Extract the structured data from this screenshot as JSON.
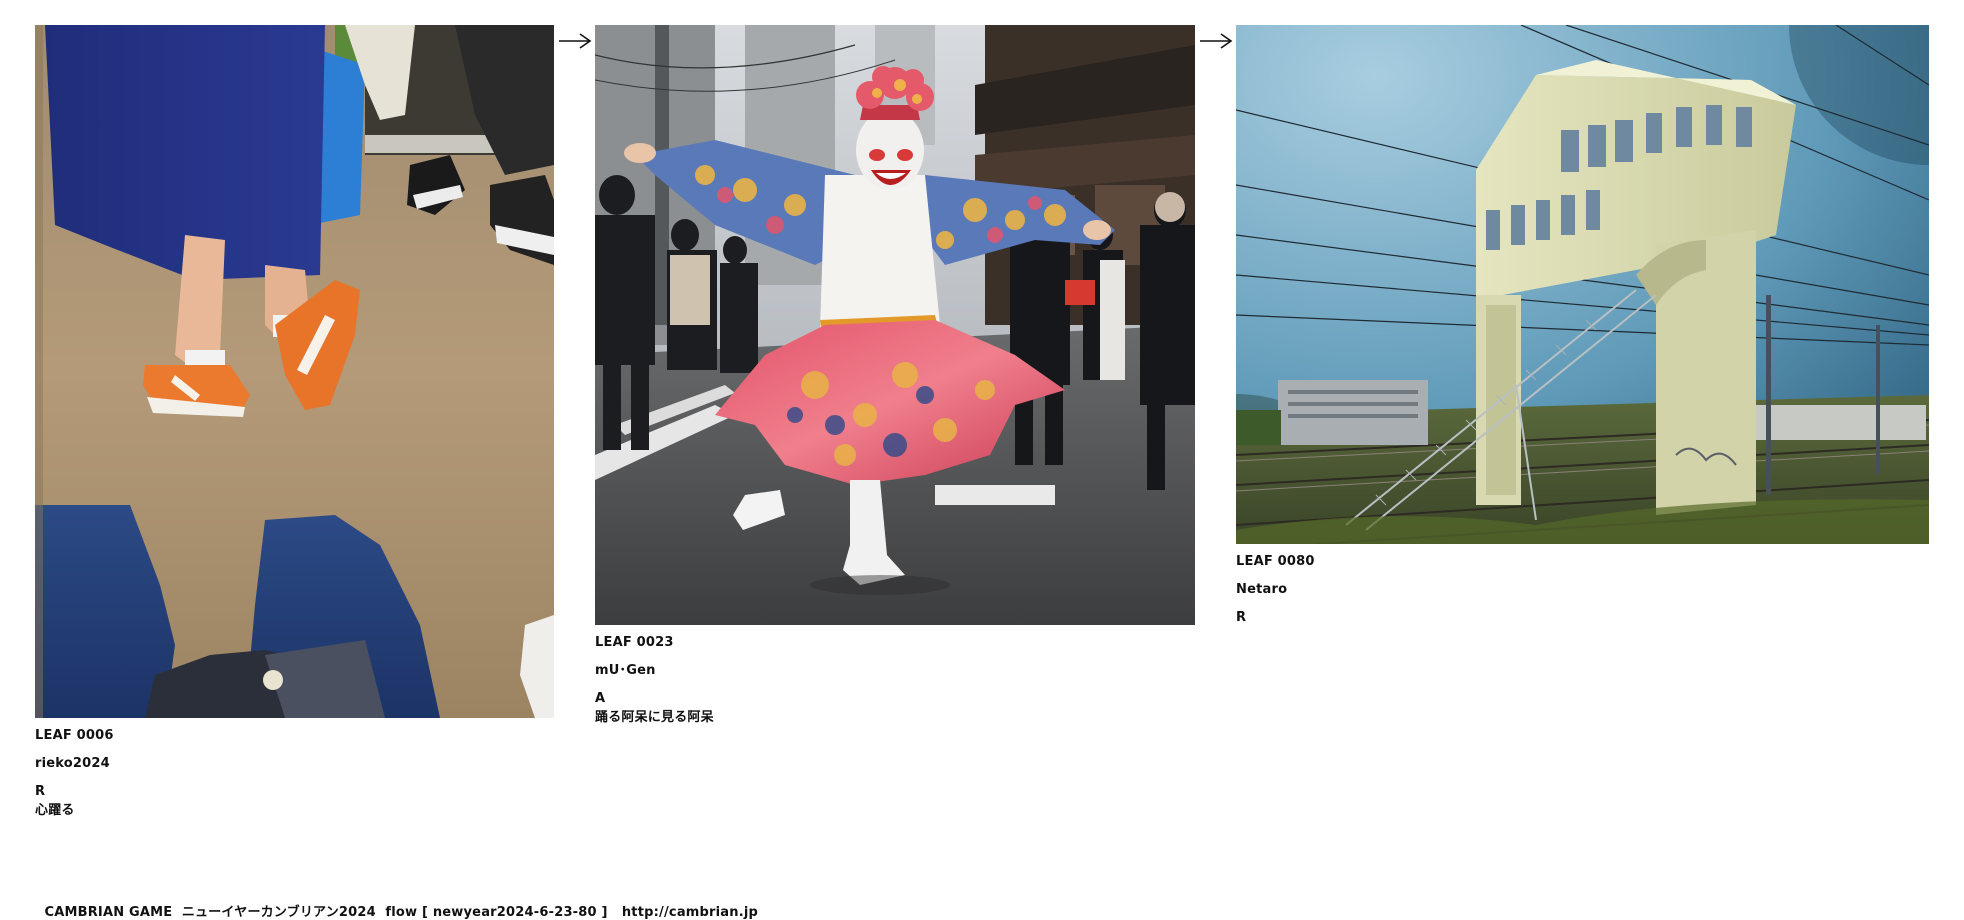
{
  "leaves": [
    {
      "id": "LEAF 0006",
      "author": "rieko2024",
      "mark": "R",
      "title": "心躍る",
      "image": "photo-train-floor-orange-sneakers"
    },
    {
      "id": "LEAF 0023",
      "author": "mU･Gen",
      "mark": "A",
      "title": "踊る阿呆に見る阿呆",
      "image": "photo-street-dancer-kimono"
    },
    {
      "id": "LEAF 0080",
      "author": "Netaro",
      "mark": "R",
      "image": "photo-railway-signal-tower"
    }
  ],
  "arrows": [
    "arrow-right-icon",
    "arrow-right-icon"
  ],
  "footer": {
    "game": "CAMBRIAN GAME",
    "event": "ニューイヤーカンブリアン2024",
    "flow": "flow [ newyear2024-6-23-80 ]",
    "url": "http://cambrian.jp"
  },
  "colors": {
    "text": "#111111",
    "background": "#ffffff"
  }
}
